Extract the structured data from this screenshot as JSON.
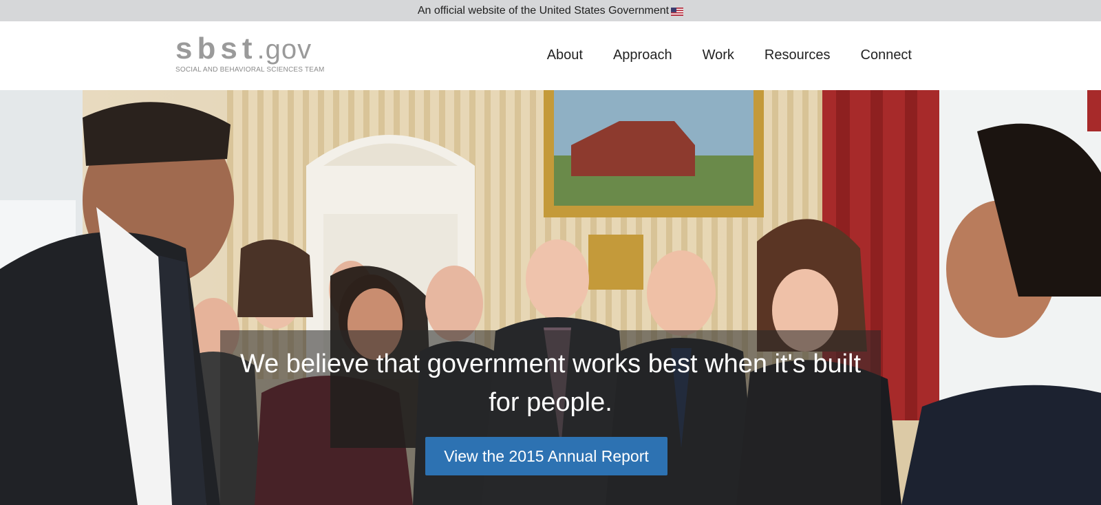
{
  "gov_banner": {
    "text": "An official website of the United States Government"
  },
  "logo": {
    "main": "sbst",
    "suffix": ".gov",
    "tagline": "SOCIAL AND BEHAVIORAL SCIENCES TEAM"
  },
  "nav": {
    "items": [
      {
        "label": "About"
      },
      {
        "label": "Approach"
      },
      {
        "label": "Work"
      },
      {
        "label": "Resources"
      },
      {
        "label": "Connect"
      }
    ]
  },
  "hero": {
    "headline": "We believe that government works best when it's built for people.",
    "button_label": "View the 2015 Annual Report"
  },
  "colors": {
    "banner_bg": "#d6d7d9",
    "button_bg": "#2d72b2",
    "logo_gray": "#9a9a9a"
  }
}
